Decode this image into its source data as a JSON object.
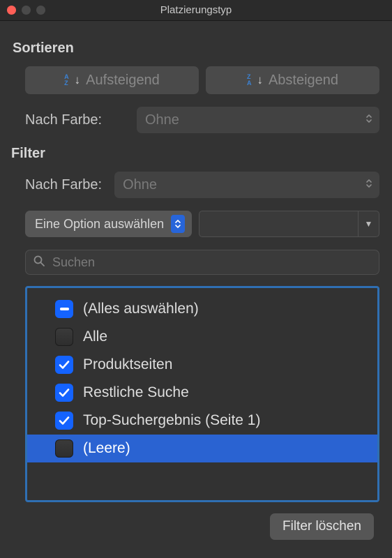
{
  "window": {
    "title": "Platzierungstyp"
  },
  "sort": {
    "heading": "Sortieren",
    "ascending": "Aufsteigend",
    "descending": "Absteigend",
    "by_color_label": "Nach Farbe:",
    "by_color_value": "Ohne"
  },
  "filter": {
    "heading": "Filter",
    "by_color_label": "Nach Farbe:",
    "by_color_value": "Ohne",
    "option_select_label": "Eine Option auswählen",
    "value_input": "",
    "search_placeholder": "Suchen",
    "items": [
      {
        "label": "(Alles auswählen)",
        "state": "indeterminate",
        "selected": false
      },
      {
        "label": "Alle",
        "state": "unchecked",
        "selected": false
      },
      {
        "label": "Produktseiten",
        "state": "checked",
        "selected": false
      },
      {
        "label": "Restliche Suche",
        "state": "checked",
        "selected": false
      },
      {
        "label": "Top-Suchergebnis (Seite 1)",
        "state": "checked",
        "selected": false
      },
      {
        "label": "(Leere)",
        "state": "unchecked",
        "selected": true
      }
    ],
    "clear_label": "Filter löschen"
  }
}
